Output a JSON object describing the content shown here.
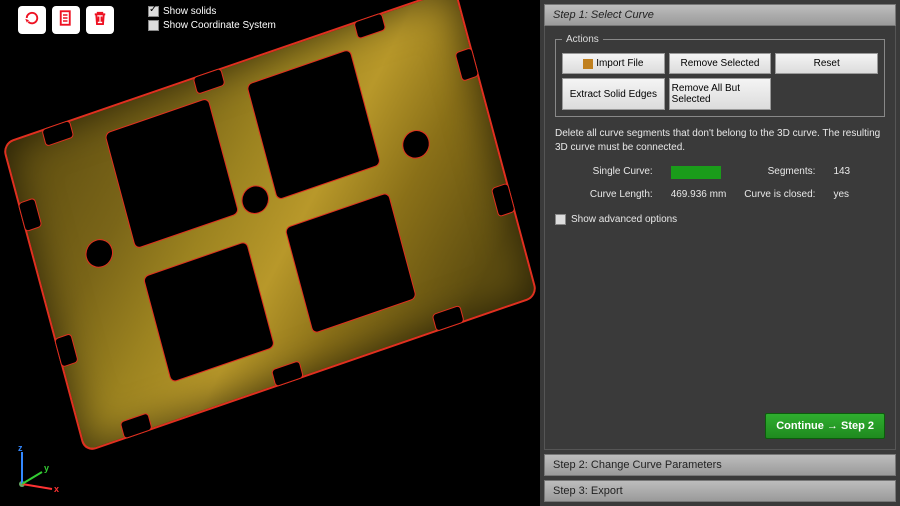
{
  "toolbar": {
    "icons": [
      "reload-icon",
      "document-icon",
      "trash-icon"
    ]
  },
  "checks": {
    "show_solids": {
      "label": "Show solids",
      "checked": true
    },
    "show_cs": {
      "label": "Show Coordinate System",
      "checked": false
    }
  },
  "axis": {
    "x": "x",
    "y": "y",
    "z": "z"
  },
  "steps": {
    "step1_title": "Step 1: Select Curve",
    "step2_title": "Step 2: Change Curve Parameters",
    "step3_title": "Step 3: Export"
  },
  "actions": {
    "legend": "Actions",
    "import_file": "Import File",
    "remove_selected": "Remove Selected",
    "reset": "Reset",
    "extract_edges": "Extract Solid Edges",
    "remove_all_but": "Remove All But Selected"
  },
  "helper_text": "Delete all curve segments that don't belong to the 3D curve. The resulting 3D curve must be connected.",
  "info": {
    "single_curve_label": "Single Curve:",
    "segments_label": "Segments:",
    "segments_value": "143",
    "length_label": "Curve Length:",
    "length_value": "469.936",
    "length_unit": "mm",
    "closed_label": "Curve is closed:",
    "closed_value": "yes"
  },
  "adv_label": "Show advanced options",
  "continue_label": "Continue → Step 2"
}
